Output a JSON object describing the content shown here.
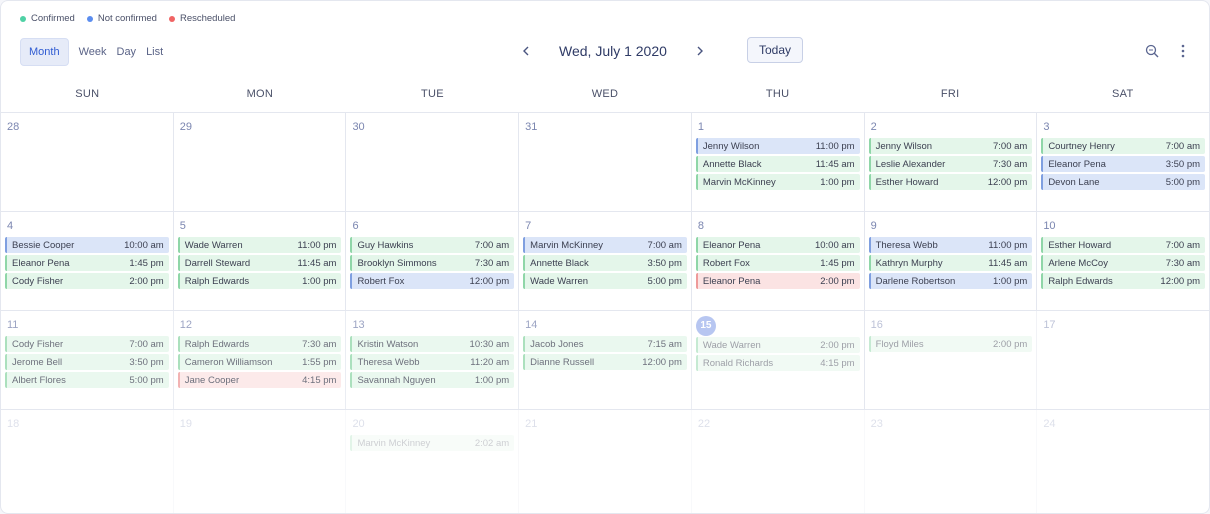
{
  "legend": [
    {
      "label": "Confirmed",
      "color": "#4fd1a5"
    },
    {
      "label": "Not confirmed",
      "color": "#5b8def"
    },
    {
      "label": "Rescheduled",
      "color": "#f06464"
    }
  ],
  "views": [
    {
      "label": "Month",
      "active": true
    },
    {
      "label": "Week",
      "active": false
    },
    {
      "label": "Day",
      "active": false
    },
    {
      "label": "List",
      "active": false
    }
  ],
  "nav": {
    "prev_icon": "chevron-left-icon",
    "title": "Wed, July 1 2020",
    "next_icon": "chevron-right-icon"
  },
  "today_label": "Today",
  "tools": {
    "search_icon": "search-zoom-icon",
    "more_icon": "more-vertical-icon"
  },
  "days_of_week": [
    "SUN",
    "MON",
    "TUE",
    "WED",
    "THU",
    "FRI",
    "SAT"
  ],
  "weeks": [
    [
      {
        "day": "28",
        "events": []
      },
      {
        "day": "29",
        "events": []
      },
      {
        "day": "30",
        "events": []
      },
      {
        "day": "31",
        "events": []
      },
      {
        "day": "1",
        "events": [
          {
            "name": "Jenny Wilson",
            "time": "11:00 pm",
            "status": "notconfirmed"
          },
          {
            "name": "Annette Black",
            "time": "11:45 am",
            "status": "confirmed"
          },
          {
            "name": "Marvin McKinney",
            "time": "1:00 pm",
            "status": "confirmed"
          }
        ]
      },
      {
        "day": "2",
        "events": [
          {
            "name": "Jenny Wilson",
            "time": "7:00 am",
            "status": "confirmed"
          },
          {
            "name": "Leslie Alexander",
            "time": "7:30 am",
            "status": "confirmed"
          },
          {
            "name": "Esther Howard",
            "time": "12:00 pm",
            "status": "confirmed"
          }
        ]
      },
      {
        "day": "3",
        "events": [
          {
            "name": "Courtney Henry",
            "time": "7:00 am",
            "status": "confirmed"
          },
          {
            "name": "Eleanor Pena",
            "time": "3:50 pm",
            "status": "notconfirmed"
          },
          {
            "name": "Devon Lane",
            "time": "5:00 pm",
            "status": "notconfirmed"
          }
        ]
      }
    ],
    [
      {
        "day": "4",
        "events": [
          {
            "name": "Bessie Cooper",
            "time": "10:00 am",
            "status": "notconfirmed"
          },
          {
            "name": "Eleanor Pena",
            "time": "1:45 pm",
            "status": "confirmed"
          },
          {
            "name": "Cody Fisher",
            "time": "2:00 pm",
            "status": "confirmed"
          }
        ]
      },
      {
        "day": "5",
        "events": [
          {
            "name": "Wade Warren",
            "time": "11:00 pm",
            "status": "confirmed"
          },
          {
            "name": "Darrell Steward",
            "time": "11:45 am",
            "status": "confirmed"
          },
          {
            "name": "Ralph Edwards",
            "time": "1:00 pm",
            "status": "confirmed"
          }
        ]
      },
      {
        "day": "6",
        "events": [
          {
            "name": "Guy Hawkins",
            "time": "7:00 am",
            "status": "confirmed"
          },
          {
            "name": "Brooklyn Simmons",
            "time": "7:30 am",
            "status": "confirmed"
          },
          {
            "name": "Robert Fox",
            "time": "12:00 pm",
            "status": "notconfirmed"
          }
        ]
      },
      {
        "day": "7",
        "events": [
          {
            "name": "Marvin McKinney",
            "time": "7:00 am",
            "status": "notconfirmed"
          },
          {
            "name": "Annette Black",
            "time": "3:50 pm",
            "status": "confirmed"
          },
          {
            "name": "Wade Warren",
            "time": "5:00 pm",
            "status": "confirmed"
          }
        ]
      },
      {
        "day": "8",
        "events": [
          {
            "name": "Eleanor Pena",
            "time": "10:00 am",
            "status": "confirmed"
          },
          {
            "name": "Robert Fox",
            "time": "1:45 pm",
            "status": "confirmed"
          },
          {
            "name": "Eleanor Pena",
            "time": "2:00 pm",
            "status": "rescheduled"
          }
        ]
      },
      {
        "day": "9",
        "events": [
          {
            "name": "Theresa Webb",
            "time": "11:00 pm",
            "status": "notconfirmed"
          },
          {
            "name": "Kathryn Murphy",
            "time": "11:45 am",
            "status": "confirmed"
          },
          {
            "name": "Darlene Robertson",
            "time": "1:00 pm",
            "status": "notconfirmed"
          }
        ]
      },
      {
        "day": "10",
        "events": [
          {
            "name": "Esther Howard",
            "time": "7:00 am",
            "status": "confirmed"
          },
          {
            "name": "Arlene McCoy",
            "time": "7:30 am",
            "status": "confirmed"
          },
          {
            "name": "Ralph Edwards",
            "time": "12:00 pm",
            "status": "confirmed"
          }
        ]
      }
    ],
    [
      {
        "day": "11",
        "events": [
          {
            "name": "Cody Fisher",
            "time": "7:00 am",
            "status": "confirmed"
          },
          {
            "name": "Jerome Bell",
            "time": "3:50 pm",
            "status": "confirmed"
          },
          {
            "name": "Albert Flores",
            "time": "5:00 pm",
            "status": "confirmed"
          }
        ]
      },
      {
        "day": "12",
        "events": [
          {
            "name": "Ralph Edwards",
            "time": "7:30 am",
            "status": "confirmed"
          },
          {
            "name": "Cameron Williamson",
            "time": "1:55 pm",
            "status": "confirmed"
          },
          {
            "name": "Jane Cooper",
            "time": "4:15 pm",
            "status": "rescheduled"
          }
        ]
      },
      {
        "day": "13",
        "events": [
          {
            "name": "Kristin Watson",
            "time": "10:30 am",
            "status": "confirmed"
          },
          {
            "name": "Theresa Webb",
            "time": "11:20 am",
            "status": "confirmed"
          },
          {
            "name": "Savannah Nguyen",
            "time": "1:00 pm",
            "status": "confirmed"
          }
        ]
      },
      {
        "day": "14",
        "events": [
          {
            "name": "Jacob Jones",
            "time": "7:15 am",
            "status": "confirmed"
          },
          {
            "name": "Dianne Russell",
            "time": "12:00 pm",
            "status": "confirmed"
          }
        ]
      },
      {
        "day": "15",
        "current": true,
        "events": [
          {
            "name": "Wade Warren",
            "time": "2:00 pm",
            "status": "confirmed"
          },
          {
            "name": "Ronald Richards",
            "time": "4:15 pm",
            "status": "confirmed"
          }
        ]
      },
      {
        "day": "16",
        "events": [
          {
            "name": "Floyd Miles",
            "time": "2:00 pm",
            "status": "confirmed"
          }
        ]
      },
      {
        "day": "17",
        "events": []
      }
    ],
    [
      {
        "day": "18",
        "events": []
      },
      {
        "day": "19",
        "events": []
      },
      {
        "day": "20",
        "events": [
          {
            "name": "Marvin McKinney",
            "time": "2:02 am",
            "status": "confirmed"
          }
        ]
      },
      {
        "day": "21",
        "events": []
      },
      {
        "day": "22",
        "events": []
      },
      {
        "day": "23",
        "events": []
      },
      {
        "day": "24",
        "events": []
      }
    ]
  ]
}
